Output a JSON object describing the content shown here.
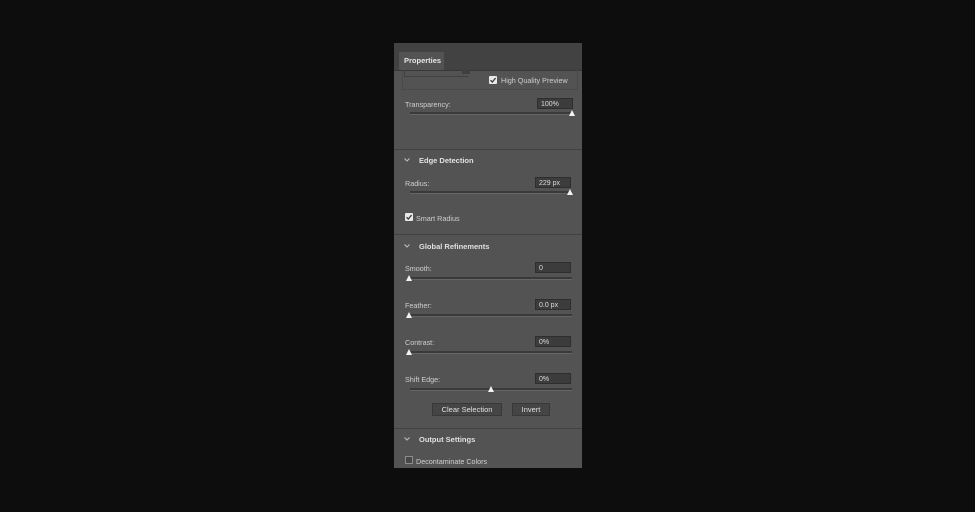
{
  "panel": {
    "tab_label": "Properties"
  },
  "view": {
    "high_quality_preview_label": "High Quality Preview",
    "high_quality_preview_checked": true,
    "transparency_label": "Transparency:",
    "transparency_value": "100%",
    "transparency_fraction": 1.0
  },
  "edge_detection": {
    "header": "Edge Detection",
    "radius_label": "Radius:",
    "radius_value": "229 px",
    "radius_fraction": 0.99,
    "smart_radius_label": "Smart Radius",
    "smart_radius_checked": true
  },
  "global_refinements": {
    "header": "Global Refinements",
    "smooth_label": "Smooth:",
    "smooth_value": "0",
    "smooth_fraction": 0.0,
    "feather_label": "Feather:",
    "feather_value": "0.0 px",
    "feather_fraction": 0.0,
    "contrast_label": "Contrast:",
    "contrast_value": "0%",
    "contrast_fraction": 0.0,
    "shift_edge_label": "Shift Edge:",
    "shift_edge_value": "0%",
    "shift_edge_fraction": 0.5,
    "clear_selection_label": "Clear Selection",
    "invert_label": "Invert"
  },
  "output_settings": {
    "header": "Output Settings",
    "decontaminate_label": "Decontaminate Colors",
    "decontaminate_checked": false
  },
  "colors": {
    "page_bg": "#0d0d0d",
    "panel_bg": "#535353",
    "field_bg": "#3c3c3c",
    "thumb": "#f2f2f2"
  }
}
